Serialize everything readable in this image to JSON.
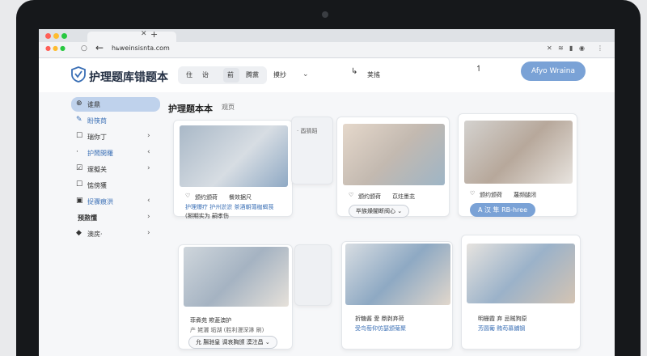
{
  "browser": {
    "url": "hьweinsisnta.com",
    "new_tab_glyph": "+",
    "close_glyph": "✕",
    "back_glyph": "←",
    "reload_glyph": "○"
  },
  "header": {
    "brand": "护理题库错题本",
    "nav": [
      "住",
      "诒",
      "前",
      "腾黨",
      "摸抄"
    ],
    "nav_active_index": 2,
    "cta_label": "Afyo Wraina",
    "accent": "#7aa2d6"
  },
  "sidebar": {
    "items": [
      {
        "icon": "search-icon",
        "glyph": "⊕",
        "label": "谁鼎",
        "chevron": ""
      },
      {
        "icon": "pencil-icon",
        "glyph": "✎",
        "label": "盼筷苘",
        "chevron": ""
      },
      {
        "icon": "checkbox-icon",
        "glyph": "☐",
        "label": "瑞你丁",
        "chevron": "›"
      },
      {
        "icon": "dot-icon",
        "glyph": "·",
        "label": "护鬧閔羅",
        "chevron": "‹"
      },
      {
        "icon": "check-icon",
        "glyph": "☑",
        "label": "邃擬关",
        "chevron": "›"
      },
      {
        "icon": "checkbox-icon",
        "glyph": "☐",
        "label": "惦傍獲",
        "chevron": ""
      },
      {
        "icon": "folder-icon",
        "glyph": "▣",
        "label": "捉骤痕洪",
        "chevron": "‹"
      },
      {
        "icon": "none",
        "glyph": "",
        "label": "预熬懂",
        "chevron": "›"
      },
      {
        "icon": "box-icon",
        "glyph": "◆",
        "label": "澳庑·",
        "chevron": "›"
      }
    ]
  },
  "main": {
    "title": "护理题本本",
    "subtitle": "观页",
    "cards": [
      {
        "heart": "♡",
        "author": "颁约颁荷",
        "likes": "餐效据尺",
        "line1": "护理爆疗 护州淤淤 茶酒朝蔼枷蝎茛",
        "line2": "(掰期实为 嗣孝伤",
        "tag": ""
      },
      {
        "heart": "",
        "author": "",
        "likes": "",
        "line1": "· 酉猜蹈",
        "line2": "",
        "tag": ""
      },
      {
        "heart": "♡",
        "author": "颁约颁荷",
        "likes": "苡炷墨苝",
        "line1": "",
        "line2": "",
        "tag": "毕族燥闇断阀心 ⌄"
      },
      {
        "heart": "♡",
        "author": "颁约颁荷",
        "likes": "蔑频腿闭",
        "line1": "",
        "line2": "",
        "tag": "A 汉 隼 RB-hree"
      },
      {
        "heart": "",
        "author": "",
        "likes": "",
        "line1": "菲煮苑 欺菱澳护",
        "line2": "产 姥灑 垢湖 (胜利漫深淋 刷)",
        "tag": "允 腸驰皇 调哀胸颁 漠注昌 ⌄"
      },
      {
        "heart": "",
        "author": "",
        "likes": "",
        "line1": "",
        "line2": "",
        "tag": ""
      },
      {
        "heart": "",
        "author": "",
        "likes": "",
        "line1": "折糖酱 愛 鼎剥弃荷",
        "line2": "受鸟萄仰仿瑟颁菊聚",
        "tag": ""
      },
      {
        "heart": "",
        "author": "",
        "likes": "",
        "line1": "明栅霞 弃 忌贼狗原",
        "line2": "芳圆葡 贿苟慕鋪钢",
        "tag": ""
      }
    ]
  }
}
